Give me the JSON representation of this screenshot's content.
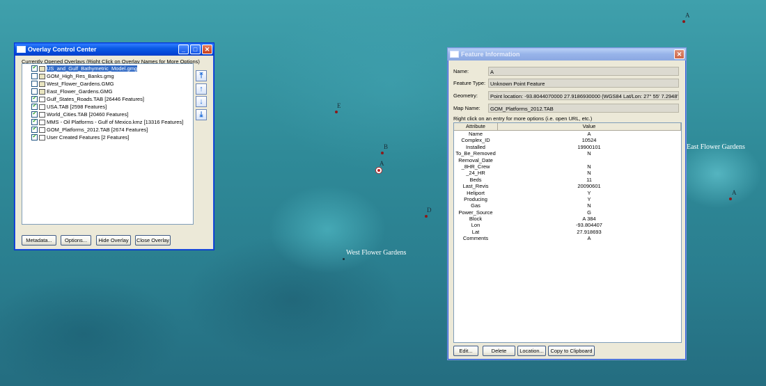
{
  "map": {
    "place_labels": [
      {
        "text": "West Flower Gardens"
      },
      {
        "text": "East Flower Gardens"
      }
    ],
    "point_labels": [
      "A",
      "E",
      "B",
      "A",
      "D",
      "A"
    ]
  },
  "overlay_control_center": {
    "title": "Overlay Control Center",
    "caption": "Currently Opened Overlays (Right Click on Overlay Names for More Options)",
    "overlays": [
      {
        "name": "US_and_Gulf_Bathymetric_Model.gmg",
        "checked": true,
        "selected": true
      },
      {
        "name": "GOM_High_Res_Banks.gmg",
        "checked": false
      },
      {
        "name": "West_Flower_Gardens.GMG",
        "checked": false
      },
      {
        "name": "East_Flower_Gardens.GMG",
        "checked": false
      },
      {
        "name": "Gulf_States_Roads.TAB [26446 Features]",
        "checked": true
      },
      {
        "name": "USA.TAB [2598 Features]",
        "checked": true
      },
      {
        "name": "World_Cities.TAB [20460 Features]",
        "checked": true
      },
      {
        "name": "MMS - Oil Platforms - Gulf of Mexico.kmz [13316 Features]",
        "checked": true
      },
      {
        "name": "GOM_Platforms_2012.TAB [2674 Features]",
        "checked": true
      },
      {
        "name": "User Created Features [2 Features]",
        "checked": true
      }
    ],
    "arrow_buttons": [
      "⤒",
      "↑",
      "↓",
      "⤓"
    ],
    "buttons": {
      "metadata": "Metadata...",
      "options": "Options...",
      "hide_overlay": "Hide Overlay",
      "close_overlay": "Close Overlay"
    },
    "title_buttons": {
      "minimize": "_",
      "maximize": "□",
      "close": "✕"
    }
  },
  "feature_information": {
    "title": "Feature Information",
    "fields": {
      "name_label": "Name:",
      "name_value": "A",
      "type_label": "Feature Type:",
      "type_value": "Unknown Point Feature",
      "geometry_label": "Geometry:",
      "geometry_value": "Point location: -93.8044070000 27.9186930000 (WGS84 Lat/Lon: 27° 55' 7.2948\" N",
      "mapname_label": "Map Name:",
      "mapname_value": "GOM_Platforms_2012.TAB"
    },
    "hint": "Right click on an entry for more options (i.e. open URL, etc.)",
    "columns": {
      "attribute": "Attribute",
      "value": "Value"
    },
    "attributes": [
      [
        "Name",
        "A"
      ],
      [
        "Complex_ID",
        "10524"
      ],
      [
        "Installed",
        "19900101"
      ],
      [
        "To_Be_Removed",
        "N"
      ],
      [
        "Removal_Date",
        ""
      ],
      [
        "_8HR_Crew",
        "N"
      ],
      [
        "_24_HR",
        "N"
      ],
      [
        "Beds",
        "11"
      ],
      [
        "Last_Revis",
        "20090601"
      ],
      [
        "Heliport",
        "Y"
      ],
      [
        "Producing",
        "Y"
      ],
      [
        "Gas",
        "N"
      ],
      [
        "Power_Source",
        "G"
      ],
      [
        "Block",
        "A 384"
      ],
      [
        "Lon",
        "-93.804407"
      ],
      [
        "Lat",
        "27.918693"
      ],
      [
        "Comments",
        "A"
      ]
    ],
    "buttons": {
      "edit": "Edit...",
      "delete": "Delete",
      "location": "Location...",
      "copy": "Copy to Clipboard"
    },
    "title_buttons": {
      "close": "✕"
    }
  }
}
